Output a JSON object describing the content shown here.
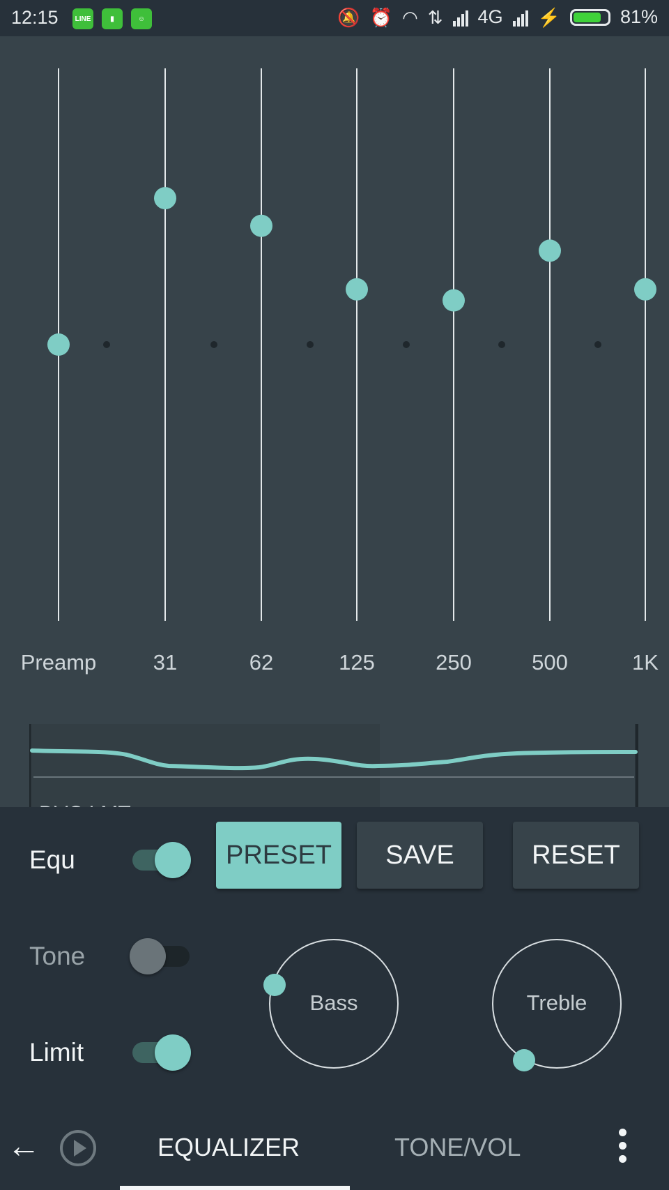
{
  "status_bar": {
    "time": "12:15",
    "network": "4G",
    "battery": "81%",
    "battery_level": 0.81,
    "icons": [
      "line-app-icon",
      "battery-saver-app-icon",
      "cat-app-icon",
      "vibrate-off-icon",
      "alarm-icon",
      "wifi-icon",
      "data-transfer-icon",
      "signal-bars-icon",
      "charging-icon",
      "battery-icon"
    ]
  },
  "equalizer": {
    "bands": [
      {
        "label": "Preamp",
        "level": 0.5
      },
      {
        "label": "31",
        "level": 0.765
      },
      {
        "label": "62",
        "level": 0.715
      },
      {
        "label": "125",
        "level": 0.6
      },
      {
        "label": "250",
        "level": 0.58
      },
      {
        "label": "500",
        "level": 0.67
      },
      {
        "label": "1K",
        "level": 0.6
      }
    ],
    "graph_label": "DVC LMT"
  },
  "controls": {
    "equ_label": "Equ",
    "equ_on": true,
    "tone_label": "Tone",
    "tone_on": false,
    "limit_label": "Limit",
    "limit_on": true,
    "preset_label": "PRESET",
    "save_label": "SAVE",
    "reset_label": "RESET",
    "bass_label": "Bass",
    "treble_label": "Treble"
  },
  "nav": {
    "tab_equalizer": "EQUALIZER",
    "tab_tone_vol": "TONE/VOL",
    "active_tab": "EQUALIZER"
  },
  "colors": {
    "accent": "#7fcdc5",
    "background": "#37434a",
    "panel": "#27313a"
  }
}
